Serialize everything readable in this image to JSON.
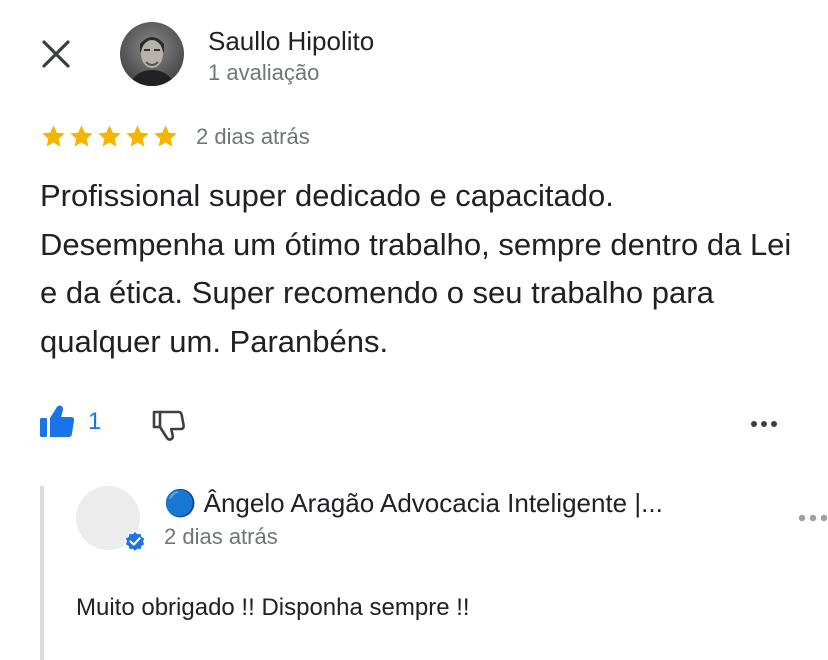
{
  "review": {
    "reviewer_name": "Saullo Hipolito",
    "reviewer_meta": "1 avaliação",
    "rating": 5,
    "date": "2 dias atrás",
    "text": "Profissional super dedicado e capacitado. Desempenha um ótimo trabalho, sempre dentro da Lei e da ética. Super recomendo o seu trabalho para qualquer um. Paranbéns.",
    "like_count": "1"
  },
  "reply": {
    "owner_name": "🔵 Ângelo Aragão Advocacia Inteligente |...",
    "date": "2 dias atrás",
    "text": "Muito obrigado !! Disponha sempre !!"
  },
  "icons": {
    "close": "close-icon",
    "star": "star-icon",
    "like": "thumbs-up-icon",
    "dislike": "thumbs-down-icon",
    "more": "more-horizontal-icon",
    "verified": "verified-badge-icon"
  },
  "colors": {
    "star": "#f4b400",
    "accent_blue": "#1a73e8",
    "secondary_text": "#70757a",
    "reply_bar": "#dadce0"
  }
}
